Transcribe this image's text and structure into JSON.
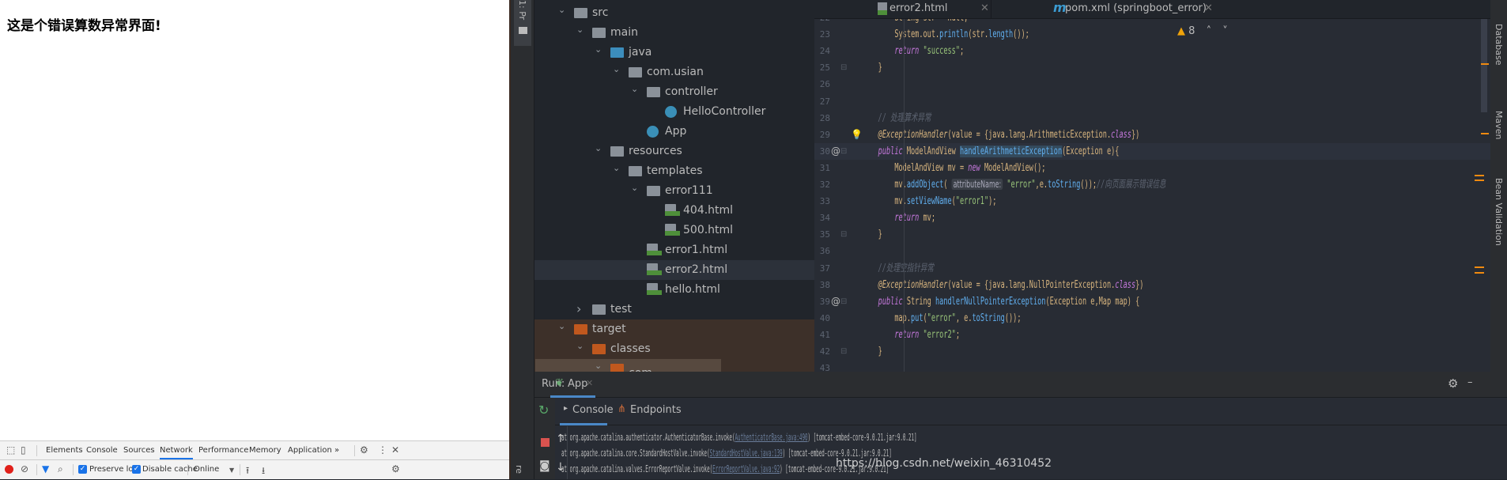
{
  "browser": {
    "heading": "这是个错误算数异常界面!"
  },
  "devtools": {
    "tabs": [
      "Elements",
      "Console",
      "Sources",
      "Network",
      "Performance",
      "Memory",
      "Application"
    ],
    "active_tab": "Network",
    "more": "»",
    "preserve_log": {
      "label": "Preserve log",
      "checked": true
    },
    "disable_cache": {
      "label": "Disable cache",
      "checked": true
    },
    "throttle": "Online"
  },
  "ide": {
    "left_strip": {
      "project_label": "1: Pr",
      "structure_label": "re"
    },
    "right_strip": [
      "Database",
      "Maven",
      "Bean Validation"
    ],
    "tree": [
      {
        "label": "src",
        "depth": 0,
        "chevron": "open",
        "icon": "folder"
      },
      {
        "label": "main",
        "depth": 1,
        "chevron": "open",
        "icon": "folder"
      },
      {
        "label": "java",
        "depth": 2,
        "chevron": "open",
        "icon": "source-folder"
      },
      {
        "label": "com.usian",
        "depth": 3,
        "chevron": "open",
        "icon": "package"
      },
      {
        "label": "controller",
        "depth": 4,
        "chevron": "open",
        "icon": "package"
      },
      {
        "label": "HelloController",
        "depth": 5,
        "chevron": "none",
        "icon": "class"
      },
      {
        "label": "App",
        "depth": 4,
        "chevron": "none",
        "icon": "spring-app"
      },
      {
        "label": "resources",
        "depth": 2,
        "chevron": "open",
        "icon": "resources-folder"
      },
      {
        "label": "templates",
        "depth": 3,
        "chevron": "open",
        "icon": "folder"
      },
      {
        "label": "error111",
        "depth": 4,
        "chevron": "open",
        "icon": "folder"
      },
      {
        "label": "404.html",
        "depth": 5,
        "chevron": "none",
        "icon": "html"
      },
      {
        "label": "500.html",
        "depth": 5,
        "chevron": "none",
        "icon": "html"
      },
      {
        "label": "error1.html",
        "depth": 4,
        "chevron": "none",
        "icon": "html"
      },
      {
        "label": "error2.html",
        "depth": 4,
        "chevron": "none",
        "icon": "html",
        "selected": true
      },
      {
        "label": "hello.html",
        "depth": 4,
        "chevron": "none",
        "icon": "html"
      },
      {
        "label": "test",
        "depth": 1,
        "chevron": "closed",
        "icon": "folder"
      },
      {
        "label": "target",
        "depth": 0,
        "chevron": "open",
        "icon": "excluded-folder"
      },
      {
        "label": "classes",
        "depth": 1,
        "chevron": "open",
        "icon": "excluded-folder"
      },
      {
        "label": "com",
        "depth": 2,
        "chevron": "open",
        "icon": "excluded-folder"
      }
    ],
    "editor_tabs": [
      {
        "label": "error2.html",
        "icon": "html"
      },
      {
        "label": "pom.xml (springboot_error)",
        "icon": "maven"
      }
    ],
    "warnings": "8",
    "code": [
      {
        "n": "22",
        "t": [
          [
            "        String str = null;",
            "pl"
          ]
        ]
      },
      {
        "n": "23",
        "t": [
          [
            "        System.",
            "pl"
          ],
          [
            "out",
            "pl"
          ],
          [
            ".",
            "pl"
          ],
          [
            "println",
            "fn"
          ],
          [
            "(str.",
            "pl"
          ],
          [
            "length",
            "fn"
          ],
          [
            "());",
            "pl"
          ]
        ]
      },
      {
        "n": "24",
        "t": [
          [
            "        ",
            "pl"
          ],
          [
            "return ",
            "kw"
          ],
          [
            "\"success\"",
            "str"
          ],
          [
            ";",
            "pl"
          ]
        ]
      },
      {
        "n": "25",
        "t": [
          [
            "    }",
            "pl"
          ]
        ],
        "fold": true
      },
      {
        "n": "26",
        "t": []
      },
      {
        "n": "27",
        "t": []
      },
      {
        "n": "28",
        "t": [
          [
            "    // 处理算术异常",
            "cm"
          ]
        ]
      },
      {
        "n": "29",
        "t": [
          [
            "    @ExceptionHandler",
            "an"
          ],
          [
            "(value = {java.lang.ArithmeticException.",
            "pl"
          ],
          [
            "class",
            "kw"
          ],
          [
            "})",
            "pl"
          ]
        ],
        "bulb": true
      },
      {
        "n": "30",
        "t": [
          [
            "    ",
            "pl"
          ],
          [
            "public ",
            "kw"
          ],
          [
            "ModelAndView ",
            "pl"
          ],
          [
            "handleArithmeticException",
            "fn"
          ],
          [
            "(Exception e){",
            "pl"
          ]
        ],
        "at": true,
        "fold": true,
        "current": true
      },
      {
        "n": "31",
        "t": [
          [
            "        ModelAndView mv = ",
            "pl"
          ],
          [
            "new ",
            "kw"
          ],
          [
            "ModelAndView();",
            "pl"
          ]
        ]
      },
      {
        "n": "32",
        "t": [
          [
            "        mv.",
            "pl"
          ],
          [
            "addObject",
            "fn"
          ],
          [
            "( ",
            "pl"
          ],
          [
            "attributeName:",
            "hint"
          ],
          [
            " \"error\"",
            "str"
          ],
          [
            ",e.",
            "pl"
          ],
          [
            "toString",
            "fn"
          ],
          [
            "());",
            "pl"
          ],
          [
            "//向页面展示错误信息",
            "cm"
          ]
        ]
      },
      {
        "n": "33",
        "t": [
          [
            "        mv.",
            "pl"
          ],
          [
            "setViewName",
            "fn"
          ],
          [
            "(",
            "pl"
          ],
          [
            "\"error1\"",
            "str"
          ],
          [
            ");",
            "pl"
          ]
        ]
      },
      {
        "n": "34",
        "t": [
          [
            "        ",
            "pl"
          ],
          [
            "return ",
            "kw"
          ],
          [
            "mv;",
            "pl"
          ]
        ]
      },
      {
        "n": "35",
        "t": [
          [
            "    }",
            "pl"
          ]
        ],
        "fold": true
      },
      {
        "n": "36",
        "t": []
      },
      {
        "n": "37",
        "t": [
          [
            "    //处理空指针异常",
            "cm"
          ]
        ]
      },
      {
        "n": "38",
        "t": [
          [
            "    @ExceptionHandler",
            "an"
          ],
          [
            "(value = {java.lang.NullPointerException.",
            "pl"
          ],
          [
            "class",
            "kw"
          ],
          [
            "})",
            "pl"
          ]
        ]
      },
      {
        "n": "39",
        "t": [
          [
            "    ",
            "pl"
          ],
          [
            "public ",
            "kw"
          ],
          [
            "String ",
            "pl"
          ],
          [
            "handlerNullPointerException",
            "fn"
          ],
          [
            "(Exception e,Map map) {",
            "pl"
          ]
        ],
        "at": true,
        "fold": true
      },
      {
        "n": "40",
        "t": [
          [
            "        map.",
            "pl"
          ],
          [
            "put",
            "fn"
          ],
          [
            "(",
            "pl"
          ],
          [
            "\"error\"",
            "str"
          ],
          [
            ", e.",
            "pl"
          ],
          [
            "toString",
            "fn"
          ],
          [
            "());",
            "pl"
          ]
        ]
      },
      {
        "n": "41",
        "t": [
          [
            "        ",
            "pl"
          ],
          [
            "return ",
            "kw"
          ],
          [
            "\"error2\"",
            "str"
          ],
          [
            ";",
            "pl"
          ]
        ]
      },
      {
        "n": "42",
        "t": [
          [
            "    }",
            "pl"
          ]
        ],
        "fold": true
      },
      {
        "n": "43",
        "t": []
      }
    ],
    "run": {
      "label": "Run:",
      "config": "App",
      "tabs": [
        "Console",
        "Endpoints"
      ],
      "lines": [
        [
          "at org.apache.catalina.authenticator.AuthenticatorBase.invoke(",
          "AuthenticatorBase.java:490",
          ") [tomcat-embed-core-9.0.21.jar:9.0.21]"
        ],
        [
          "at org.apache.catalina.core.StandardHostValve.invoke(",
          "StandardHostValve.java:139",
          ") [tomcat-embed-core-9.0.21.jar:9.0.21]"
        ],
        [
          "at org.apache.catalina.valves.ErrorReportValve.invoke(",
          "ErrorReportValve.java:92",
          ") [tomcat-embed-core-9.0.21.jar:9.0.21]"
        ]
      ]
    }
  },
  "watermark": "https://blog.csdn.net/weixin_46310452",
  "colors": {
    "editor_bg": "#282c34",
    "tree_bg": "#21252b",
    "accent": "#4a88c7",
    "excluded": "#3d3029"
  }
}
